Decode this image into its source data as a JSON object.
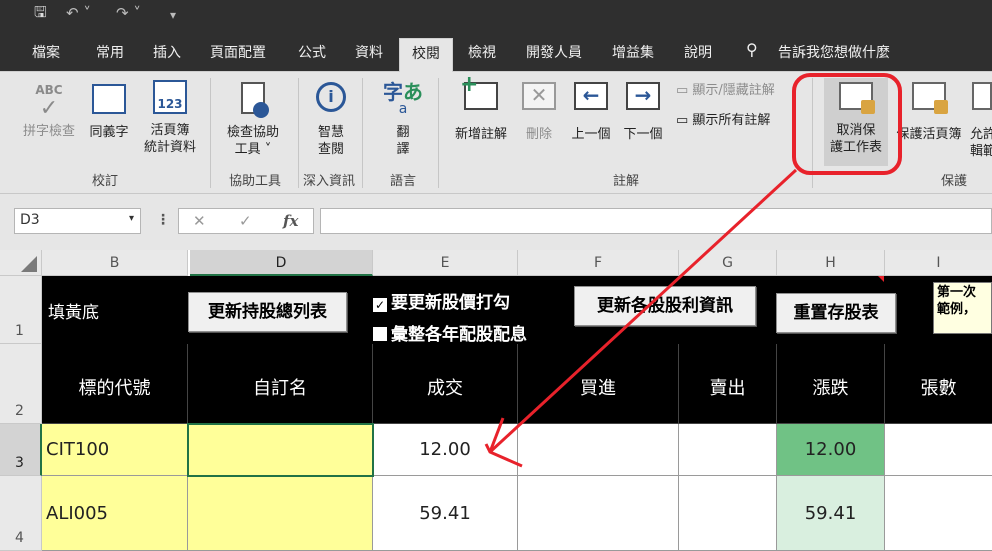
{
  "qat": {
    "save_icon": "save-icon",
    "undo_icon": "undo-icon",
    "redo_icon": "redo-icon",
    "customize_icon": "customize-icon"
  },
  "tabs": [
    "檔案",
    "常用",
    "插入",
    "頁面配置",
    "公式",
    "資料",
    "校閱",
    "檢視",
    "開發人員",
    "增益集",
    "說明"
  ],
  "active_tab": "校閱",
  "tell_me": "告訴我您想做什麼",
  "ribbon": {
    "proofing": {
      "abc": "ABC",
      "spelling": "拼字檢查",
      "thesaurus": "同義字",
      "stats_line1": "活頁簿",
      "stats_line2": "統計資料",
      "group": "校訂"
    },
    "accessibility": {
      "check_line1": "檢查協助",
      "check_line2": "工具 ˅",
      "group": "協助工具"
    },
    "insights": {
      "smart_line1": "智慧",
      "smart_line2": "查閱",
      "group": "深入資訊"
    },
    "language": {
      "translate_line1": "翻",
      "translate_line2": "譯",
      "group": "語言"
    },
    "comments": {
      "new": "新增註解",
      "delete": "刪除",
      "previous": "上一個",
      "next": "下一個",
      "show_hide": "顯示/隱藏註解",
      "show_all": "顯示所有註解",
      "group": "註解"
    },
    "protect": {
      "unprotect_line1": "取消保",
      "unprotect_line2": "護工作表",
      "protect_workbook": "保護活頁簿",
      "allow_line1": "允許",
      "allow_line2": "輯範",
      "group": "保護"
    }
  },
  "formula_bar": {
    "name_box": "D3",
    "cancel": "✕",
    "enter": "✓",
    "fx": "fx",
    "value": ""
  },
  "sheet": {
    "columns": [
      "B",
      "D",
      "E",
      "F",
      "G",
      "H",
      "I"
    ],
    "rows": [
      "1",
      "2",
      "3",
      "4"
    ],
    "row1": {
      "label": "填黃底",
      "btn_update_list": "更新持股總列表",
      "chk_update_price": "要更新股價打勾",
      "chk_summary": "彙整各年配股配息",
      "btn_update_dividend": "更新各股股利資訊",
      "btn_reset": "重置存股表",
      "note_line1": "第一次",
      "note_line2": "範例，"
    },
    "headers": [
      "標的代號",
      "自訂名",
      "成交",
      "買進",
      "賣出",
      "漲跌",
      "張數"
    ],
    "data": [
      {
        "code": "CIT100",
        "name": "",
        "price": "12.00",
        "buy": "",
        "sell": "",
        "change": "12.00",
        "shares": ""
      },
      {
        "code": "ALI005",
        "name": "",
        "price": "59.41",
        "buy": "",
        "sell": "",
        "change": "59.41",
        "shares": ""
      }
    ]
  },
  "colors": {
    "accent_tab_bg": "#e6e6e6",
    "header_bg": "#000000",
    "input_fill": "#ffff99",
    "change_up": "#70c285",
    "change_light": "#d9efdf",
    "annotation": "#e8222b"
  }
}
